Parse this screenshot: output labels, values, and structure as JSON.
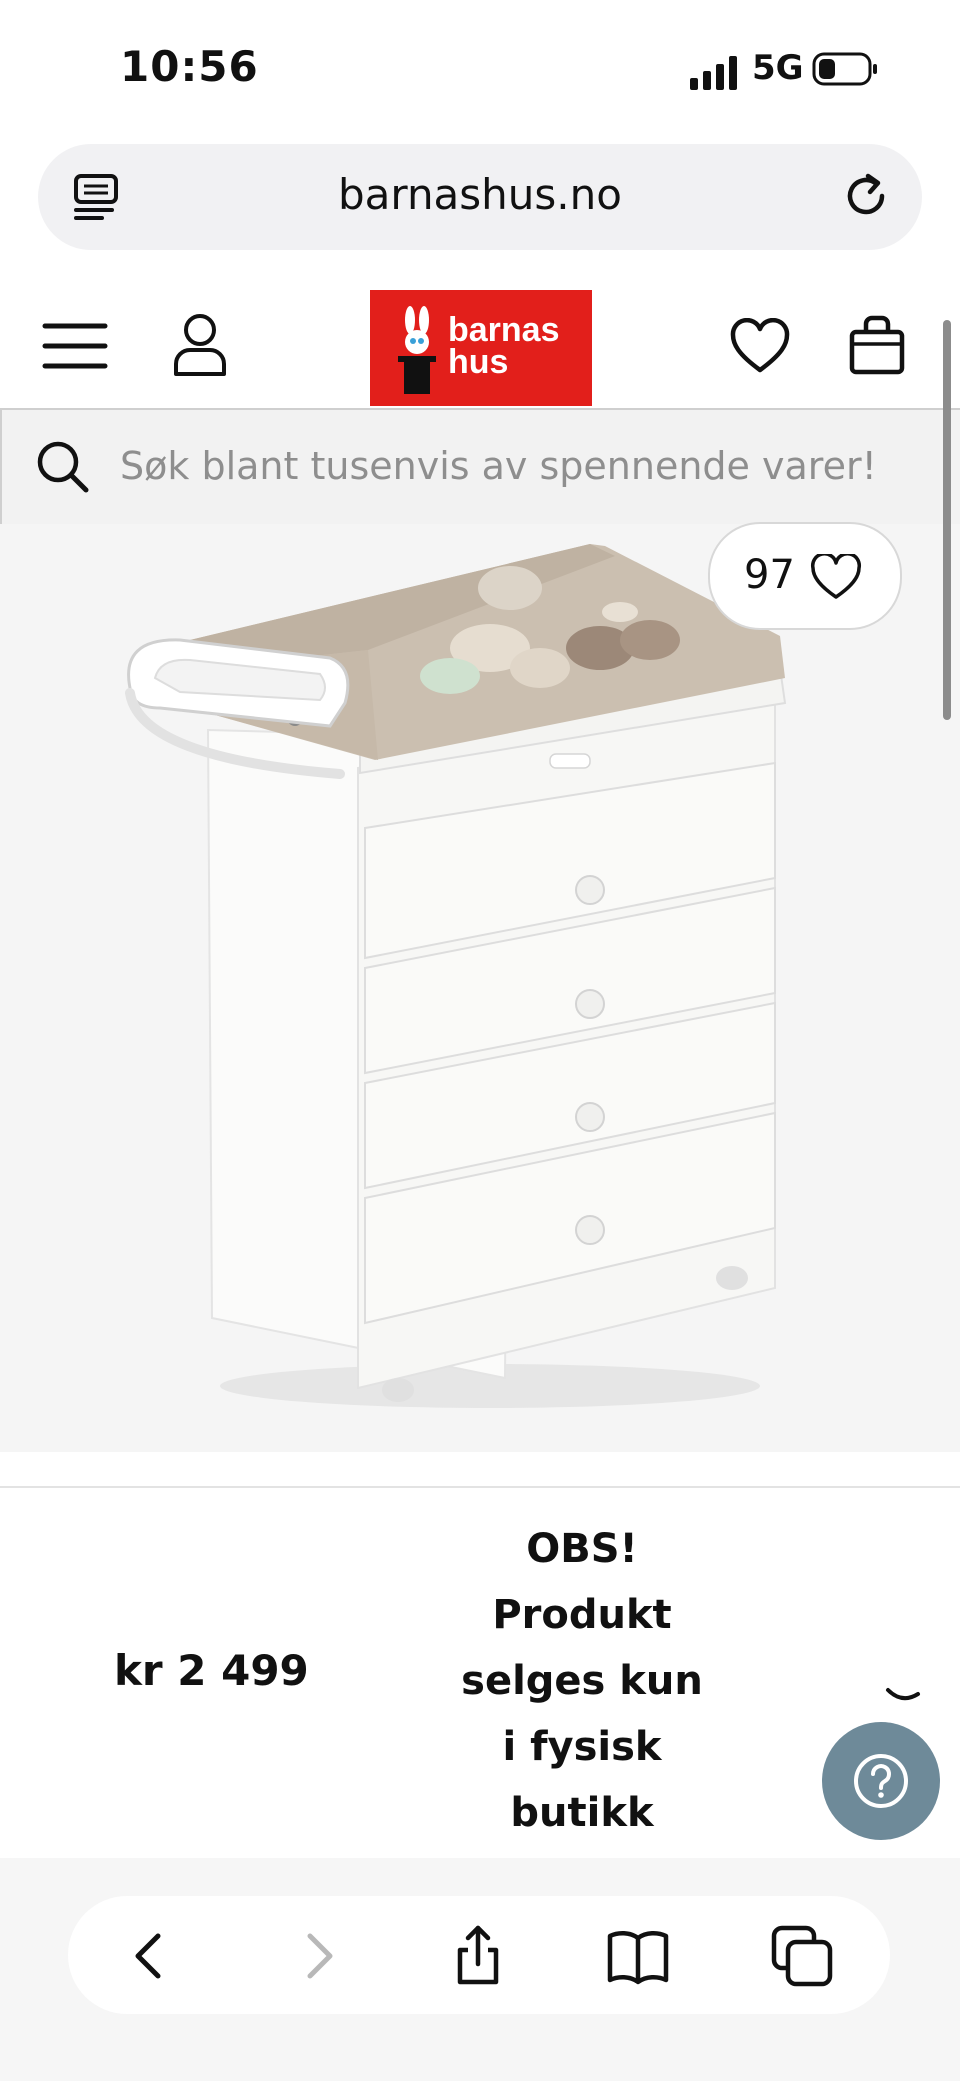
{
  "status_bar": {
    "time": "10:56",
    "network": "5G"
  },
  "browser": {
    "url": "barnashus.no"
  },
  "site": {
    "logo": {
      "line1": "barnas",
      "line2": "hus",
      "color": "#e21f1b"
    },
    "search": {
      "placeholder": "Søk blant tusenvis av spennende varer!"
    }
  },
  "product": {
    "favorites_count": "97",
    "price": "kr 2 499",
    "notice": [
      "OBS!",
      "Produkt",
      "selges kun",
      "i fysisk",
      "butikk"
    ]
  },
  "icons": [
    "tabs-icon",
    "reload-icon",
    "menu-icon",
    "user-icon",
    "heart-icon",
    "bag-icon",
    "search-icon",
    "help-icon",
    "back-icon",
    "forward-icon",
    "share-icon",
    "bookmarks-icon",
    "tabs-overview-icon"
  ],
  "colors": {
    "help_button": "#6e8a99",
    "brand_red": "#e21f1b"
  }
}
